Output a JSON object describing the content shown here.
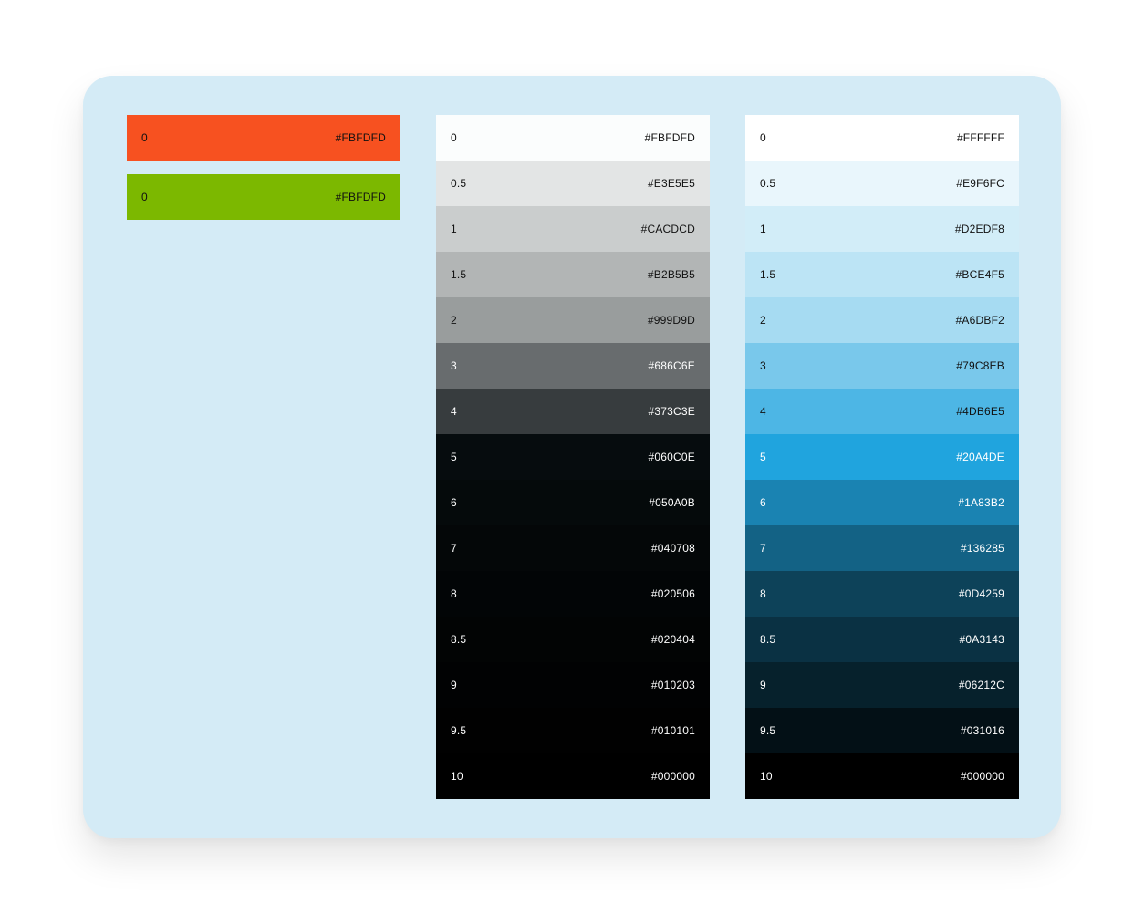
{
  "accents": [
    {
      "label": "0",
      "hex": "#FBFDFD",
      "color": "#F75120",
      "text_color": "#111111"
    },
    {
      "label": "0",
      "hex": "#FBFDFD",
      "color": "#7CB800",
      "text_color": "#111111"
    }
  ],
  "neutral": [
    {
      "label": "0",
      "hex": "#FBFDFD",
      "color": "#FBFDFD",
      "text_color": "#111111"
    },
    {
      "label": "0.5",
      "hex": "#E3E5E5",
      "color": "#E3E5E5",
      "text_color": "#111111"
    },
    {
      "label": "1",
      "hex": "#CACDCD",
      "color": "#CACDCD",
      "text_color": "#111111"
    },
    {
      "label": "1.5",
      "hex": "#B2B5B5",
      "color": "#B2B5B5",
      "text_color": "#111111"
    },
    {
      "label": "2",
      "hex": "#999D9D",
      "color": "#999D9D",
      "text_color": "#111111"
    },
    {
      "label": "3",
      "hex": "#686C6E",
      "color": "#686C6E",
      "text_color": "#ffffff"
    },
    {
      "label": "4",
      "hex": "#373C3E",
      "color": "#373C3E",
      "text_color": "#ffffff"
    },
    {
      "label": "5",
      "hex": "#060C0E",
      "color": "#060C0E",
      "text_color": "#ffffff"
    },
    {
      "label": "6",
      "hex": "#050A0B",
      "color": "#050A0B",
      "text_color": "#ffffff"
    },
    {
      "label": "7",
      "hex": "#040708",
      "color": "#040708",
      "text_color": "#ffffff"
    },
    {
      "label": "8",
      "hex": "#020506",
      "color": "#020506",
      "text_color": "#ffffff"
    },
    {
      "label": "8.5",
      "hex": "#020404",
      "color": "#020404",
      "text_color": "#ffffff"
    },
    {
      "label": "9",
      "hex": "#010203",
      "color": "#010203",
      "text_color": "#ffffff"
    },
    {
      "label": "9.5",
      "hex": "#010101",
      "color": "#010101",
      "text_color": "#ffffff"
    },
    {
      "label": "10",
      "hex": "#000000",
      "color": "#000000",
      "text_color": "#ffffff"
    }
  ],
  "blue": [
    {
      "label": "0",
      "hex": "#FFFFFF",
      "color": "#FFFFFF",
      "text_color": "#111111"
    },
    {
      "label": "0.5",
      "hex": "#E9F6FC",
      "color": "#E9F6FC",
      "text_color": "#111111"
    },
    {
      "label": "1",
      "hex": "#D2EDF8",
      "color": "#D2EDF8",
      "text_color": "#111111"
    },
    {
      "label": "1.5",
      "hex": "#BCE4F5",
      "color": "#BCE4F5",
      "text_color": "#111111"
    },
    {
      "label": "2",
      "hex": "#A6DBF2",
      "color": "#A6DBF2",
      "text_color": "#111111"
    },
    {
      "label": "3",
      "hex": "#79C8EB",
      "color": "#79C8EB",
      "text_color": "#111111"
    },
    {
      "label": "4",
      "hex": "#4DB6E5",
      "color": "#4DB6E5",
      "text_color": "#111111"
    },
    {
      "label": "5",
      "hex": "#20A4DE",
      "color": "#20A4DE",
      "text_color": "#ffffff"
    },
    {
      "label": "6",
      "hex": "#1A83B2",
      "color": "#1A83B2",
      "text_color": "#ffffff"
    },
    {
      "label": "7",
      "hex": "#136285",
      "color": "#136285",
      "text_color": "#ffffff"
    },
    {
      "label": "8",
      "hex": "#0D4259",
      "color": "#0D4259",
      "text_color": "#ffffff"
    },
    {
      "label": "8.5",
      "hex": "#0A3143",
      "color": "#0A3143",
      "text_color": "#ffffff"
    },
    {
      "label": "9",
      "hex": "#06212C",
      "color": "#06212C",
      "text_color": "#ffffff"
    },
    {
      "label": "9.5",
      "hex": "#031016",
      "color": "#031016",
      "text_color": "#ffffff"
    },
    {
      "label": "10",
      "hex": "#000000",
      "color": "#000000",
      "text_color": "#ffffff"
    }
  ]
}
